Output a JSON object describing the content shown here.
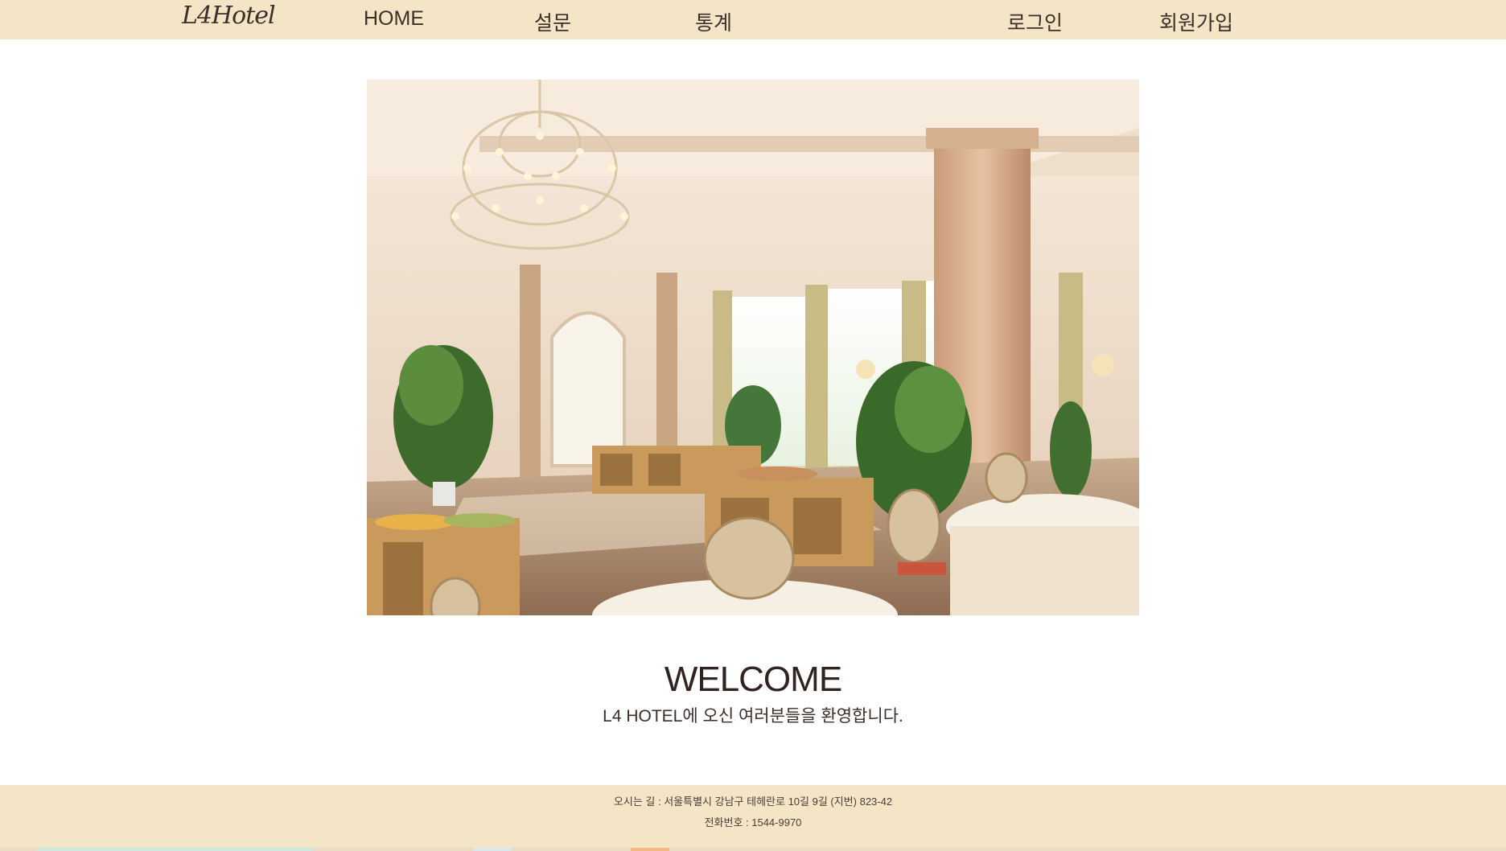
{
  "nav": {
    "logo": "L4Hotel",
    "home": "HOME",
    "survey": "설문",
    "stats": "통계",
    "login": "로그인",
    "signup": "회원가입"
  },
  "main": {
    "welcome_title": "WELCOME",
    "welcome_subtitle": "L4 HOTEL에 오신 여러분들을 환영합니다."
  },
  "footer": {
    "address": "오시는 길 : 서울특별시 강남구 테헤란로 10길 9길 (지번) 823-42",
    "phone": "전화번호 : 1544-9970"
  },
  "colors": {
    "nav_bg": "#f4e5c6",
    "footer_bg": "#f4e5c6",
    "text": "#3b2f2a"
  }
}
